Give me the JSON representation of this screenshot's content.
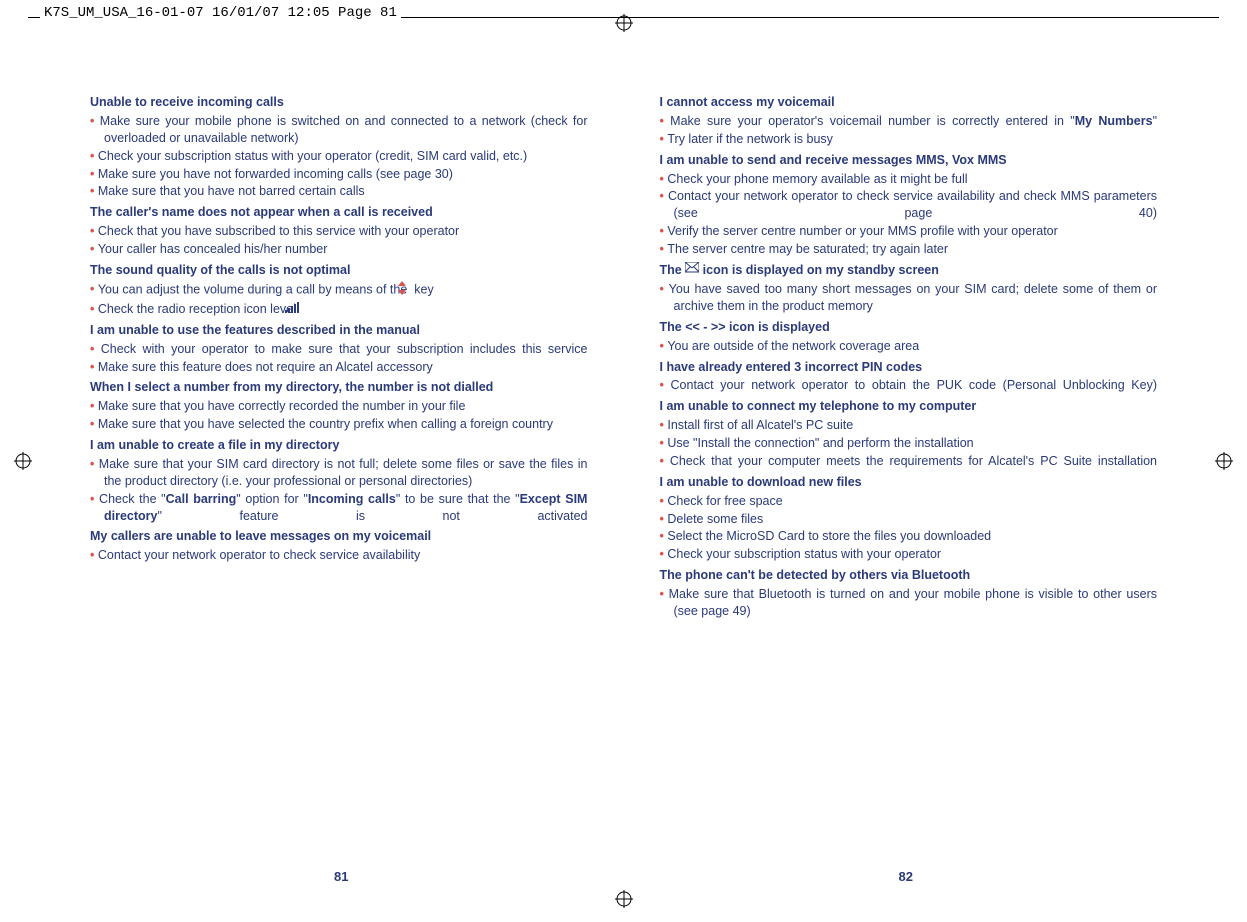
{
  "header": "K7S_UM_USA_16-01-07  16/01/07  12:05  Page 81",
  "pages": {
    "left": "81",
    "right": "82"
  },
  "left_sections": [
    {
      "title": "Unable to receive incoming calls",
      "items": [
        {
          "text": "Make sure your mobile phone is switched on and connected to a network (check for overloaded or unavailable network)"
        },
        {
          "text": "Check your subscription status with your operator (credit, SIM card valid, etc.)"
        },
        {
          "text": "Make sure you have not forwarded incoming calls (see page 30)"
        },
        {
          "text": "Make sure that you have not barred certain calls"
        }
      ]
    },
    {
      "title": "The caller's name does not appear when a call is received",
      "items": [
        {
          "text": "Check that you have subscribed to this service with your operator"
        },
        {
          "text": "Your caller has concealed his/her number"
        }
      ]
    },
    {
      "title": "The sound quality of the calls is not optimal",
      "items": [
        {
          "html": "You can adjust the volume during a call by means of the <span class='inline-icon' data-name='up-down-arrow-icon' data-interactable='false'><svg width='10' height='14'><polygon points='5,0 9,5 1,5' fill='#d9534f'/><polygon points='5,14 9,9 1,9' fill='#d9534f'/></svg></span> key"
        },
        {
          "html": "Check the radio reception icon level <span class='inline-icon' data-name='signal-bars-icon' data-interactable='false'><svg width='16' height='12'><rect x='0' y='9' width='2' height='3' fill='#2a3a7a'/><rect x='3' y='7' width='2' height='5' fill='#2a3a7a'/><rect x='6' y='5' width='2' height='7' fill='#2a3a7a'/><rect x='9' y='3' width='2' height='9' fill='#2a3a7a'/><rect x='12' y='1' width='2' height='11' fill='#2a3a7a'/></svg></span>"
        }
      ]
    },
    {
      "title": "I am unable to use the features described in the manual",
      "items": [
        {
          "text": "Check with your operator to make sure that your subscription includes this service",
          "justify": true
        },
        {
          "text": "Make sure this feature does not require an Alcatel accessory"
        }
      ]
    },
    {
      "title": "When I select a number from my directory, the number is not dialled",
      "items": [
        {
          "text": "Make sure that you have correctly recorded the number in your file"
        },
        {
          "text": "Make sure that you have selected the country prefix when calling a foreign country"
        }
      ]
    },
    {
      "title": "I am unable to create a file in my directory",
      "items": [
        {
          "text": "Make sure that your SIM card directory is not full; delete some files or save the files in the product directory (i.e. your professional or personal directories)"
        },
        {
          "html": "Check the \"<span class='bold'>Call barring</span>\" option for \"<span class='bold'>Incoming calls</span>\" to be sure that the \"<span class='bold'>Except SIM directory</span>\" feature is not activated",
          "justify": true
        }
      ]
    },
    {
      "title": "My callers are unable to leave messages on my voicemail",
      "items": [
        {
          "text": "Contact your network operator to check service availability"
        }
      ]
    }
  ],
  "right_sections": [
    {
      "title": "I cannot access my voicemail",
      "items": [
        {
          "html": "Make sure your operator's voicemail number is correctly entered in \"<span class='bold'>My Numbers</span>\"",
          "justify": true
        },
        {
          "text": "Try later if the network is busy"
        }
      ]
    },
    {
      "title": "I am unable to send and receive messages MMS, Vox MMS",
      "items": [
        {
          "text": "Check your phone memory available as it might be full"
        },
        {
          "text": "Contact your network operator to check service availability and check MMS parameters (see page 40)",
          "justify": true
        },
        {
          "text": "Verify the server centre number or your MMS profile with your operator"
        },
        {
          "text": "The server centre may be saturated; try again later"
        }
      ]
    },
    {
      "title_html": "The <span class='inline-icon' data-name='message-icon' data-interactable='false'><svg width='14' height='12'><rect x='0' y='0' width='14' height='10' fill='none' stroke='#2a3a7a'/><line x1='0' y1='0' x2='7' y2='6' stroke='#2a3a7a'/><line x1='14' y1='0' x2='7' y2='6' stroke='#2a3a7a'/><line x1='0' y1='10' x2='5' y2='5' stroke='#2a3a7a'/><line x1='14' y1='10' x2='9' y2='5' stroke='#2a3a7a'/></svg></span> icon is displayed on my standby screen",
      "items": [
        {
          "text": "You have saved too many short messages on your SIM card; delete some of them or archive them in the product memory"
        }
      ]
    },
    {
      "title": "The << - >> icon is displayed",
      "items": [
        {
          "text": "You are outside of the network coverage area"
        }
      ]
    },
    {
      "title": "I have already entered 3 incorrect PIN codes",
      "items": [
        {
          "text": "Contact your network operator to obtain the PUK code (Personal Unblocking Key)",
          "justify": true
        }
      ]
    },
    {
      "title": "I am unable to connect my telephone to my computer",
      "items": [
        {
          "text": "Install first of all Alcatel's PC suite"
        },
        {
          "text": "Use \"Install the connection\" and perform the installation"
        },
        {
          "text": "Check that your computer meets the requirements for Alcatel's PC Suite installation",
          "justify": true
        }
      ]
    },
    {
      "title": "I am unable to download new files",
      "items": [
        {
          "text": "Check for free space"
        },
        {
          "text": "Delete some files"
        },
        {
          "text": "Select the MicroSD Card to store the files you downloaded"
        },
        {
          "text": "Check your subscription status with your operator"
        }
      ]
    },
    {
      "title": "The phone can't be detected by others via Bluetooth",
      "items": [
        {
          "text": "Make sure that Bluetooth is turned on and your mobile phone is visible to other users (see page 49)"
        }
      ]
    }
  ]
}
